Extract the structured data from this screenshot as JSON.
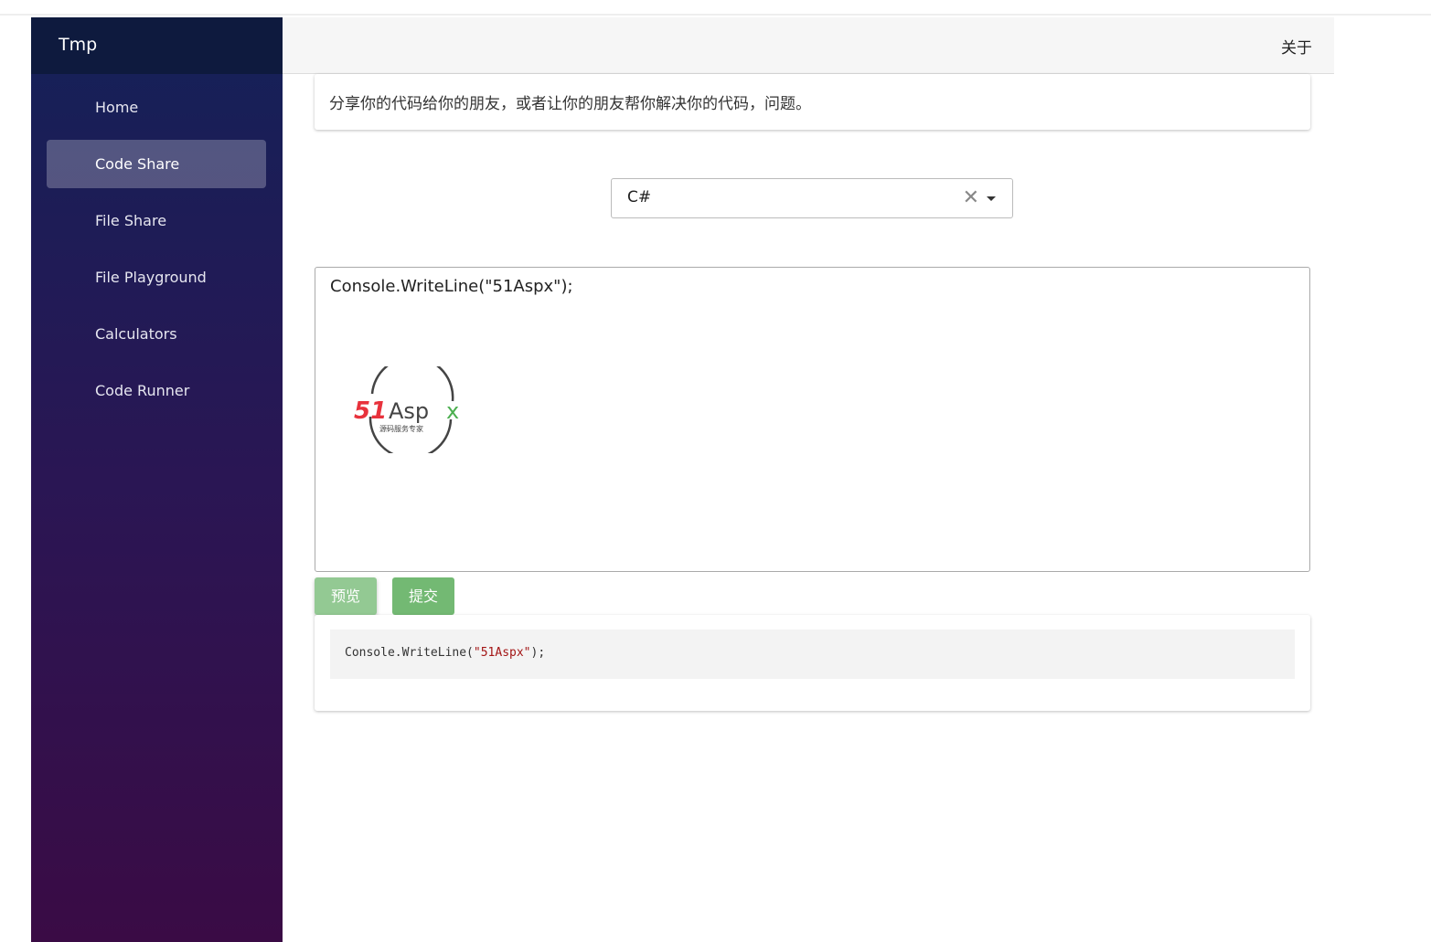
{
  "app": {
    "title": "Tmp"
  },
  "sidebar": {
    "items": [
      {
        "label": "Home"
      },
      {
        "label": "Code Share",
        "active": true
      },
      {
        "label": "File Share"
      },
      {
        "label": "File Playground"
      },
      {
        "label": "Calculators"
      },
      {
        "label": "Code Runner"
      }
    ]
  },
  "topbar": {
    "about": "关于"
  },
  "intro": "分享你的代码给你的朋友，或者让你的朋友帮你解决你的代码，问题。",
  "language_select": {
    "value": "C#"
  },
  "editor": {
    "text": "Console.WriteLine(\"51Aspx\");",
    "logo": {
      "brand": "51Aspx",
      "tagline": "源码服务专家"
    }
  },
  "buttons": {
    "preview": "预览",
    "submit": "提交"
  },
  "output": {
    "prefix": "Console.WriteLine(",
    "string": "\"51Aspx\"",
    "suffix": ");"
  },
  "colors": {
    "sidebar_top": "#142158",
    "sidebar_bottom": "#3a0b45",
    "button_green": "#73b973"
  }
}
